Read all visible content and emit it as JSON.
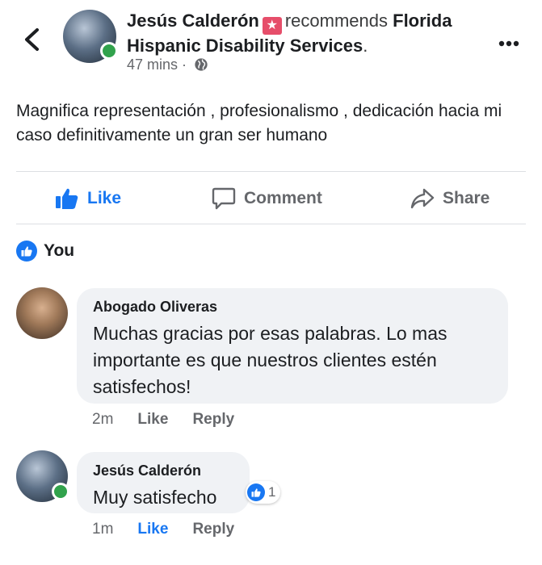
{
  "post": {
    "author": "Jesús Calderón",
    "verb": "recommends",
    "page": "Florida Hispanic Disability Services",
    "period": ".",
    "time": "47 mins",
    "separator": "·",
    "privacy_icon": "globe-icon",
    "body": "Magnifica representación , profesionalismo , dedicación hacia mi caso definitivamente un gran ser humano"
  },
  "actions": {
    "like": "Like",
    "comment": "Comment",
    "share": "Share"
  },
  "reactions": {
    "summary": "You"
  },
  "comments": [
    {
      "author": "Abogado Oliveras",
      "text": "Muchas gracias por esas palabras. Lo mas importante es que nuestros clientes estén satisfechos!",
      "time": "2m",
      "like": "Like",
      "reply": "Reply"
    },
    {
      "author": "Jesús Calderón",
      "text": "Muy satisfecho",
      "time": "1m",
      "like": "Like",
      "reply": "Reply",
      "reaction_count": "1"
    }
  ],
  "colors": {
    "accent": "#1877f2",
    "online": "#31a24c",
    "bubble": "#f0f2f5",
    "secondary_text": "#65676b"
  }
}
